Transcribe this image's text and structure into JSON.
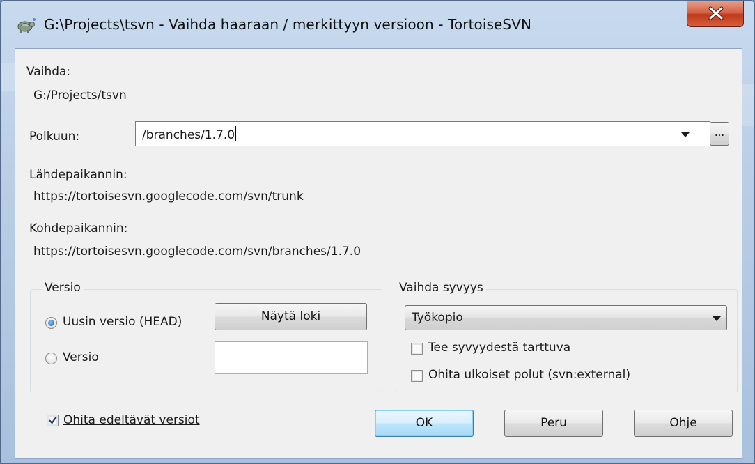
{
  "window": {
    "title": "G:\\Projects\\tsvn - Vaihda haaraan / merkittyyn versioon - TortoiseSVN"
  },
  "switch": {
    "label": "Vaihda:",
    "path": "G:/Projects/tsvn"
  },
  "to_path": {
    "label": "Polkuun:",
    "value": "/branches/1.7.0",
    "browse_label": "..."
  },
  "source_repo": {
    "label": "Lähdepaikannin:",
    "url": "https://tortoisesvn.googlecode.com/svn/trunk"
  },
  "target_repo": {
    "label": "Kohdepaikannin:",
    "url": "https://tortoisesvn.googlecode.com/svn/branches/1.7.0"
  },
  "revision_group": {
    "title": "Versio",
    "head_label": "Uusin versio (HEAD)",
    "show_log_label": "Näytä loki",
    "revision_label": "Versio",
    "revision_value": "",
    "selected": "head"
  },
  "depth_group": {
    "title": "Vaihda syvyys",
    "depth_value": "Työkopio",
    "sticky_label": "Tee syvyydestä tarttuva",
    "sticky_checked": false,
    "ignore_externals_label": "Ohita ulkoiset polut (svn:external)",
    "ignore_externals_checked": false
  },
  "ignore_ancestry": {
    "label": "Ohita edeltävät versiot",
    "checked": true
  },
  "buttons": {
    "ok": "OK",
    "cancel": "Peru",
    "help": "Ohje"
  },
  "colors": {
    "close_button": "#c9452a",
    "default_button_border": "#3c7fb1",
    "radio_selected": "#1a5fb0"
  },
  "icons": {
    "app": "tortoisesvn-turtle-icon",
    "close": "close-icon",
    "dropdown": "chevron-down-icon",
    "checkmark": "checkmark-icon"
  }
}
